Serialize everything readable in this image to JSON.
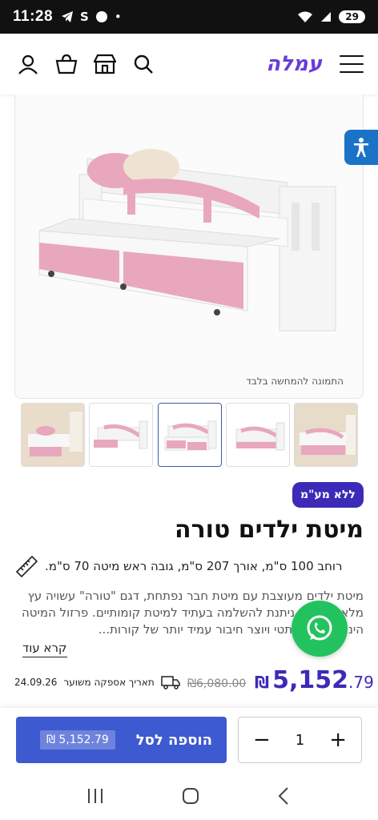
{
  "status": {
    "time": "11:28",
    "battery": "29"
  },
  "header": {
    "logo": "עמלה"
  },
  "product": {
    "image_caption": "התמונה להמחשה בלבד",
    "badge": "ללא מע\"מ",
    "title": "מיטת ילדים טורה",
    "dimensions": "רוחב 100 ס\"מ, אורך 207 ס\"מ, גובה ראש מיטה 70 ס\"מ.",
    "description": "מיטת ילדים מעוצבת עם מיטת חבר נפתחת, דגם \"טורה\" עשויה עץ מלא. המיטה ניתנת להשלמה בעתיד למיטת קומותיים. פרזול המיטה הינו פנימי ואסתטי ויוצר חיבור עמיד יותר של קורות...",
    "read_more": "קרא עוד",
    "delivery_label": "תאריך אספקה משוער",
    "delivery_date": "24.09.26",
    "old_price": "6,080.00",
    "currency": "₪",
    "price_int": "5,152",
    "price_dec": ".79"
  },
  "cart": {
    "price_chip": "₪ 5,152.79",
    "add_label": "הוספה לסל",
    "quantity": "1",
    "plus": "+",
    "minus": "−"
  },
  "colors": {
    "accent": "#3b2bb8",
    "button": "#3d5ad0",
    "pink": "#e8a7bd",
    "whatsapp": "#22c35e"
  }
}
